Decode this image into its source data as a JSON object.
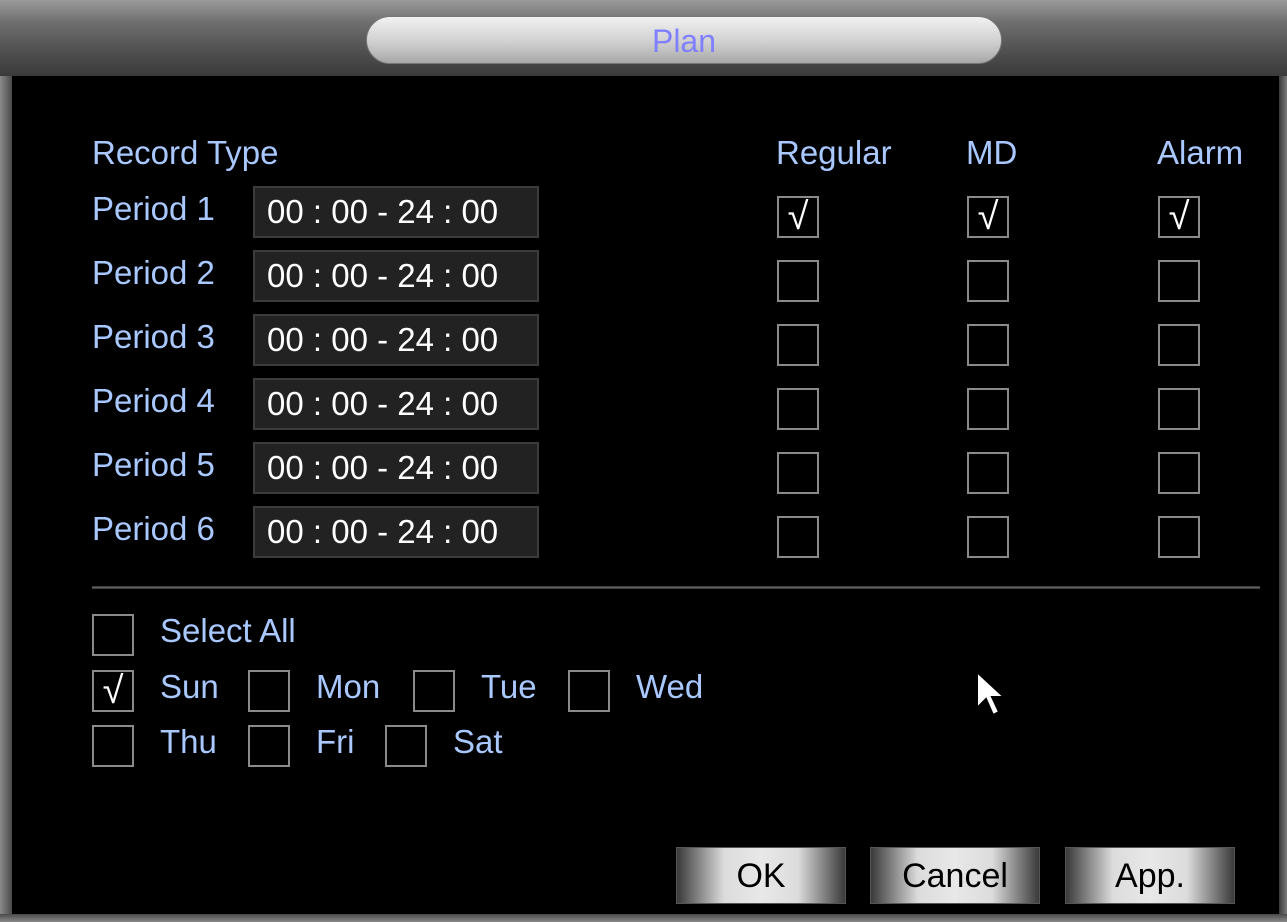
{
  "window": {
    "title": "Plan"
  },
  "header": {
    "record_type": "Record Type"
  },
  "columns": [
    "Regular",
    "MD",
    "Alarm"
  ],
  "periods": [
    {
      "label": "Period 1",
      "time": "00 : 00 - 24 : 00",
      "checks": [
        true,
        true,
        true
      ]
    },
    {
      "label": "Period 2",
      "time": "00 : 00 - 24 : 00",
      "checks": [
        false,
        false,
        false
      ]
    },
    {
      "label": "Period 3",
      "time": "00 : 00 - 24 : 00",
      "checks": [
        false,
        false,
        false
      ]
    },
    {
      "label": "Period 4",
      "time": "00 : 00 - 24 : 00",
      "checks": [
        false,
        false,
        false
      ]
    },
    {
      "label": "Period 5",
      "time": "00 : 00 - 24 : 00",
      "checks": [
        false,
        false,
        false
      ]
    },
    {
      "label": "Period 6",
      "time": "00 : 00 - 24 : 00",
      "checks": [
        false,
        false,
        false
      ]
    }
  ],
  "days": {
    "select_all": {
      "label": "Select All",
      "checked": false
    },
    "items": [
      {
        "label": "Sun",
        "checked": true
      },
      {
        "label": "Mon",
        "checked": false
      },
      {
        "label": "Tue",
        "checked": false
      },
      {
        "label": "Wed",
        "checked": false
      },
      {
        "label": "Thu",
        "checked": false
      },
      {
        "label": "Fri",
        "checked": false
      },
      {
        "label": "Sat",
        "checked": false
      }
    ]
  },
  "checkmark": "√",
  "buttons": {
    "ok": "OK",
    "cancel": "Cancel",
    "apply": "App."
  }
}
